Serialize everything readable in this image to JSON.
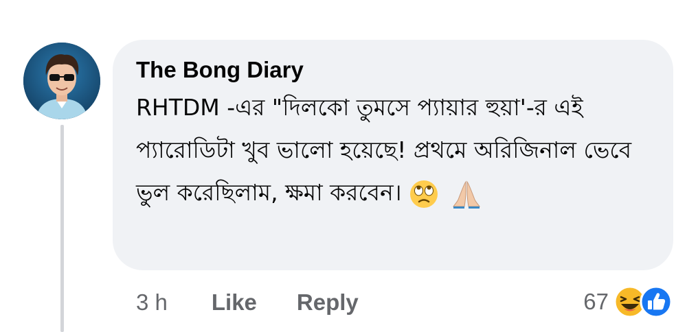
{
  "comment": {
    "author": "The Bong Diary",
    "text": "RHTDM -এর \"দিলকো তুমসে প্যায়ার হুয়া'-র এই প্যারোডিটা খুব ভালো হয়েছে! প্রথমে অরিজিনাল ভেবে ভুল করেছিলাম, ক্ষমা করবেন।",
    "emojis": [
      "face-with-rolling-eyes-icon",
      "folded-hands-icon"
    ],
    "timestamp": "3 h",
    "like_label": "Like",
    "reply_label": "Reply",
    "reaction_count": "67",
    "reaction_icons": [
      "laughing-reaction-icon",
      "like-reaction-icon"
    ]
  },
  "colors": {
    "bubble": "#f0f2f5",
    "text": "#050505",
    "secondary": "#65676b",
    "like_blue": "#1877f2",
    "haha_yellow": "#f7b928"
  }
}
